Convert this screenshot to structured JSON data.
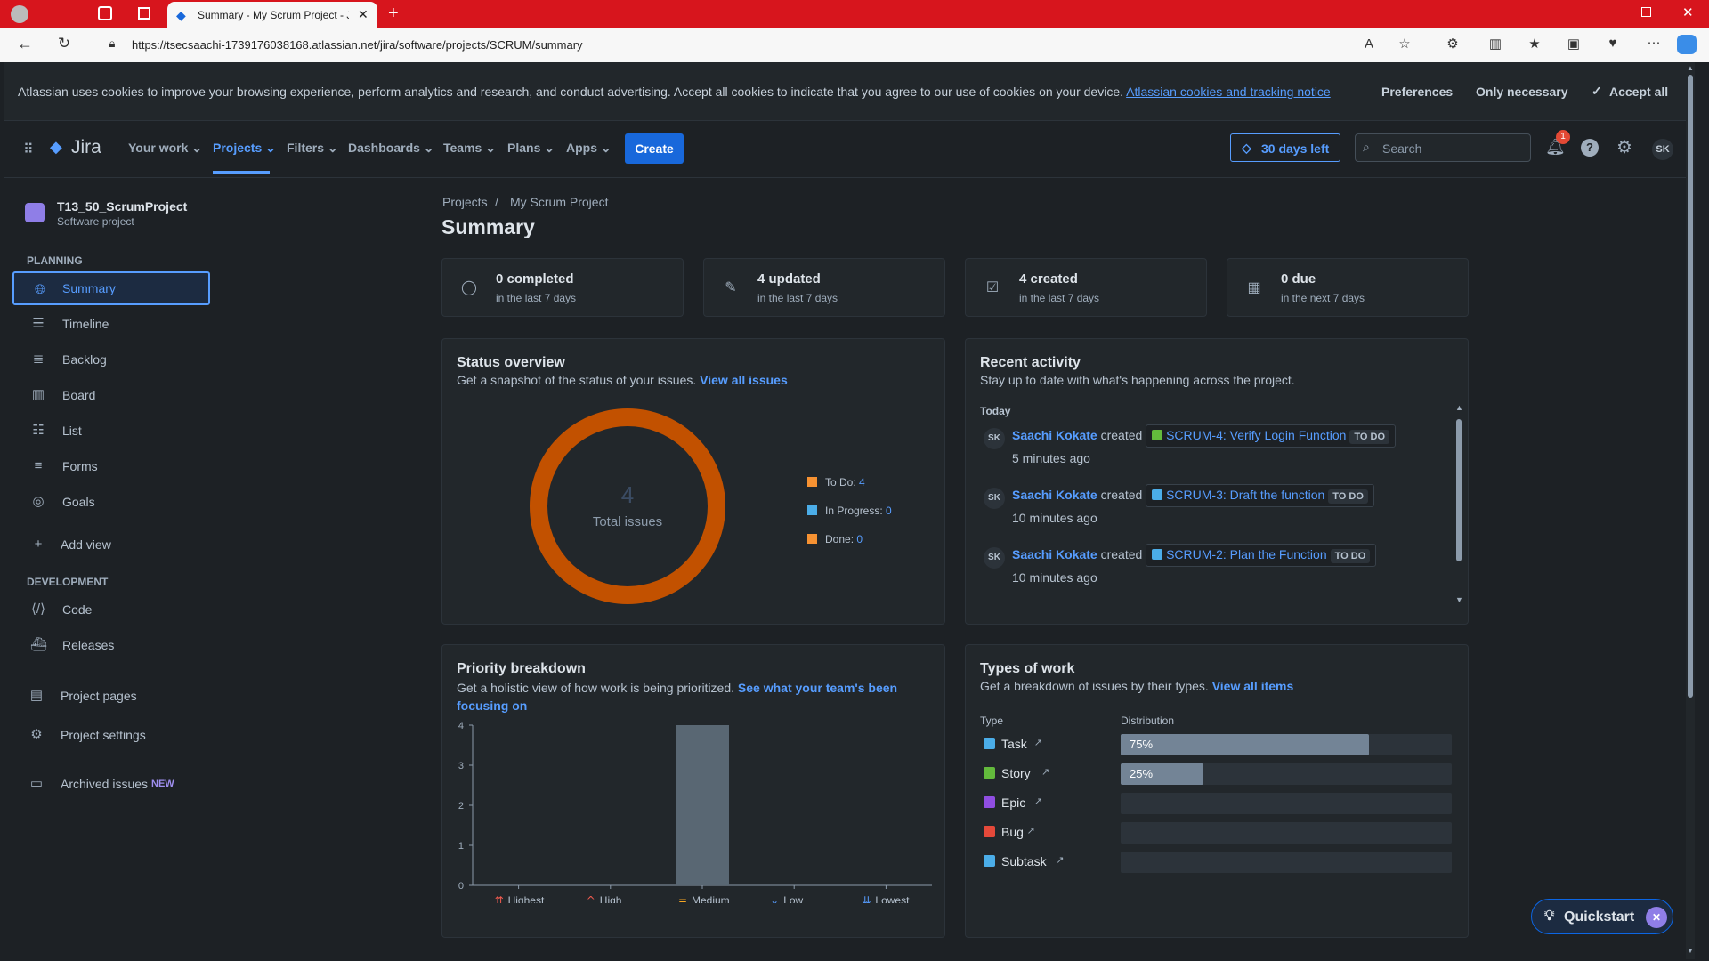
{
  "browser": {
    "tab_title": "Summary - My Scrum Project - Ji",
    "url": "https://tsecsaachi-1739176038168.atlassian.net/jira/software/projects/SCRUM/summary"
  },
  "cookie_banner": {
    "text": "Atlassian uses cookies to improve your browsing experience, perform analytics and research, and conduct advertising. Accept all cookies to indicate that you agree to our use of cookies on your device.",
    "link": "Atlassian cookies and tracking notice",
    "preferences": "Preferences",
    "only_necessary": "Only necessary",
    "accept_all": "Accept all"
  },
  "topnav": {
    "logo": "Jira",
    "items": [
      "Your work",
      "Projects",
      "Filters",
      "Dashboards",
      "Teams",
      "Plans",
      "Apps"
    ],
    "create": "Create",
    "trial": "30 days left",
    "search_placeholder": "Search",
    "notif_count": "1",
    "avatar": "SK"
  },
  "sidebar": {
    "project_name": "T13_50_ScrumProject",
    "project_type": "Software project",
    "planning_head": "PLANNING",
    "planning": [
      "Summary",
      "Timeline",
      "Backlog",
      "Board",
      "List",
      "Forms",
      "Goals"
    ],
    "add_view": "Add view",
    "dev_head": "DEVELOPMENT",
    "development": [
      "Code",
      "Releases"
    ],
    "project_pages": "Project pages",
    "project_settings": "Project settings",
    "archived": "Archived issues",
    "new_badge": "NEW"
  },
  "breadcrumb": {
    "projects": "Projects",
    "sep": "/",
    "project": "My Scrum Project"
  },
  "page_title": "Summary",
  "stats": [
    {
      "title": "0 completed",
      "sub": "in the last 7 days"
    },
    {
      "title": "4 updated",
      "sub": "in the last 7 days"
    },
    {
      "title": "4 created",
      "sub": "in the last 7 days"
    },
    {
      "title": "0 due",
      "sub": "in the next 7 days"
    }
  ],
  "status_overview": {
    "title": "Status overview",
    "sub": "Get a snapshot of the status of your issues.",
    "link": "View all issues",
    "total": "4",
    "total_label": "Total issues",
    "legend": [
      {
        "label": "To Do:",
        "value": "4",
        "color": "#f79232"
      },
      {
        "label": "In Progress:",
        "value": "0",
        "color": "#4bade8"
      },
      {
        "label": "Done:",
        "value": "0",
        "color": "#f79232"
      }
    ]
  },
  "recent_activity": {
    "title": "Recent activity",
    "sub": "Stay up to date with what's happening across the project.",
    "day": "Today",
    "items": [
      {
        "avatar": "SK",
        "user": "Saachi Kokate",
        "verb": "created",
        "issue": "SCRUM-4: Verify Login Function",
        "status": "TO DO",
        "time": "5 minutes ago",
        "type": "story"
      },
      {
        "avatar": "SK",
        "user": "Saachi Kokate",
        "verb": "created",
        "issue": "SCRUM-3: Draft the function",
        "status": "TO DO",
        "time": "10 minutes ago",
        "type": "task"
      },
      {
        "avatar": "SK",
        "user": "Saachi Kokate",
        "verb": "created",
        "issue": "SCRUM-2: Plan the Function",
        "status": "TO DO",
        "time": "10 minutes ago",
        "type": "task"
      }
    ]
  },
  "priority": {
    "title": "Priority breakdown",
    "sub": "Get a holistic view of how work is being prioritized.",
    "link1": "See what your team's been",
    "link2": "focusing on"
  },
  "chart_data": {
    "type": "bar",
    "categories": [
      "Highest",
      "High",
      "Medium",
      "Low",
      "Lowest"
    ],
    "values": [
      0,
      0,
      4,
      0,
      0
    ],
    "ylim": [
      0,
      4
    ],
    "yticks": [
      "0",
      "1",
      "2",
      "3",
      "4"
    ],
    "colors": {
      "Highest": "#f15b50",
      "High": "#f15b50",
      "Medium": "#f5a623",
      "Low": "#579dff",
      "Lowest": "#579dff"
    }
  },
  "types_of_work": {
    "title": "Types of work",
    "sub": "Get a breakdown of issues by their types.",
    "link": "View all items",
    "col_type": "Type",
    "col_dist": "Distribution",
    "rows": [
      {
        "name": "Task",
        "pct": 75,
        "pct_label": "75%",
        "color": "#4bade8"
      },
      {
        "name": "Story",
        "pct": 25,
        "pct_label": "25%",
        "color": "#63ba3c"
      },
      {
        "name": "Epic",
        "pct": 0,
        "pct_label": "",
        "color": "#904ee2"
      },
      {
        "name": "Bug",
        "pct": 0,
        "pct_label": "",
        "color": "#e5493a"
      },
      {
        "name": "Subtask",
        "pct": 0,
        "pct_label": "",
        "color": "#4bade8"
      }
    ]
  },
  "quickstart": "Quickstart"
}
